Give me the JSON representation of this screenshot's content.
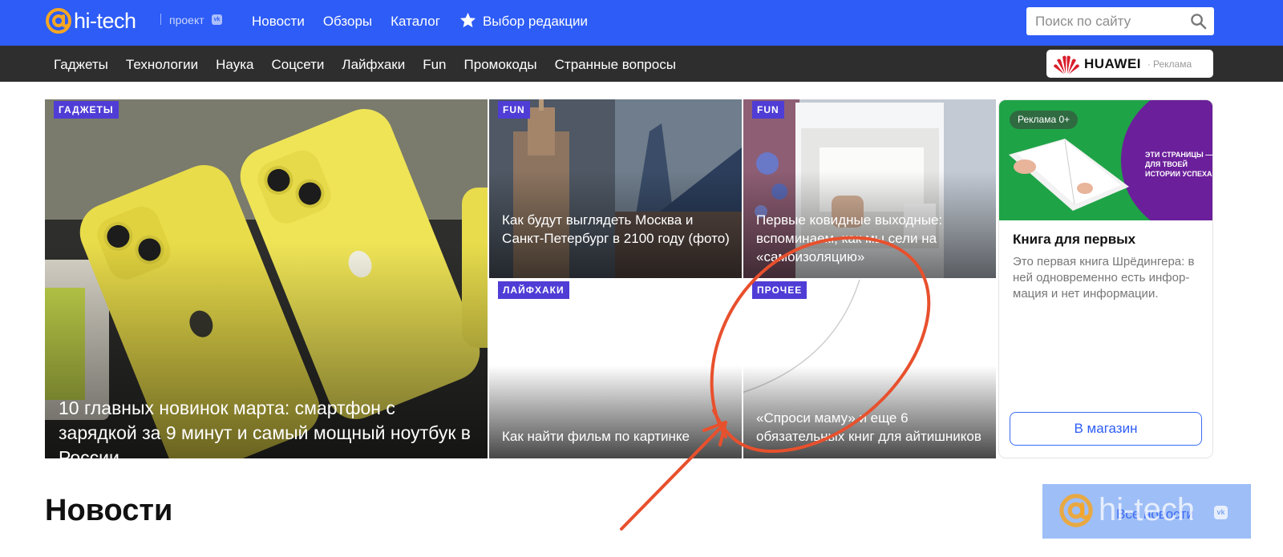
{
  "site": {
    "logo_text": "hi-tech",
    "project_label": "проект",
    "vk_badge": "vk"
  },
  "top_nav": {
    "items": [
      "Новости",
      "Обзоры",
      "Каталог"
    ],
    "featured_label": "Выбор редакции"
  },
  "search": {
    "placeholder": "Поиск по сайту"
  },
  "sub_nav": {
    "items": [
      "Гаджеты",
      "Технологии",
      "Наука",
      "Соцсети",
      "Лайфхаки",
      "Fun",
      "Промокоды",
      "Странные вопросы"
    ]
  },
  "sponsor": {
    "brand": "HUAWEI",
    "dot": "·",
    "label": "Реклама"
  },
  "hero": {
    "main": {
      "tag": "ГАДЖЕТЫ",
      "title": "10 главных новинок марта: смартфон с зарядкой за 9 минут и самый мощный ноутбук в России"
    },
    "tiles": [
      {
        "tag": "FUN",
        "title": "Как будут выглядеть Москва и Санкт-Петербург в 2100 году (фото)"
      },
      {
        "tag": "FUN",
        "title": "Первые ковидные выходные: вспоминаем, как мы сели на «самоизоляцию»"
      },
      {
        "tag": "ЛАЙФХАКИ",
        "title": "Как найти фильм по картинке"
      },
      {
        "tag": "ПРОЧЕЕ",
        "title": "«Спроси маму» и еще 6 обязательных книг для айтишников"
      }
    ]
  },
  "ad_card": {
    "badge": "Реклама 0+",
    "image_text": "ЭТИ СТРАНИЦЫ — ДЛЯ ТВОЕЙ ИСТОРИИ УСПЕХА",
    "title": "Книга для первых",
    "description": "Это первая книга Шрёдингера: в ней одновременно есть инфор-мация и нет информации.",
    "button": "В магазин"
  },
  "news": {
    "heading": "Новости",
    "all_link": "Все новости"
  },
  "watermark": {
    "text": "hi-tech",
    "vk": "vk"
  },
  "colors": {
    "brand_blue": "#2d5cf6",
    "logo_orange": "#f5a623",
    "tag_purple": "#4f3dd6",
    "subnav_bg": "#2e2e2e",
    "annotation_red": "#e8502d",
    "huawei_red": "#d81e2b"
  },
  "icons": {
    "logo": "at-sign-icon",
    "featured": "star-icon",
    "search": "search-icon",
    "sponsor": "huawei-flower-icon"
  }
}
